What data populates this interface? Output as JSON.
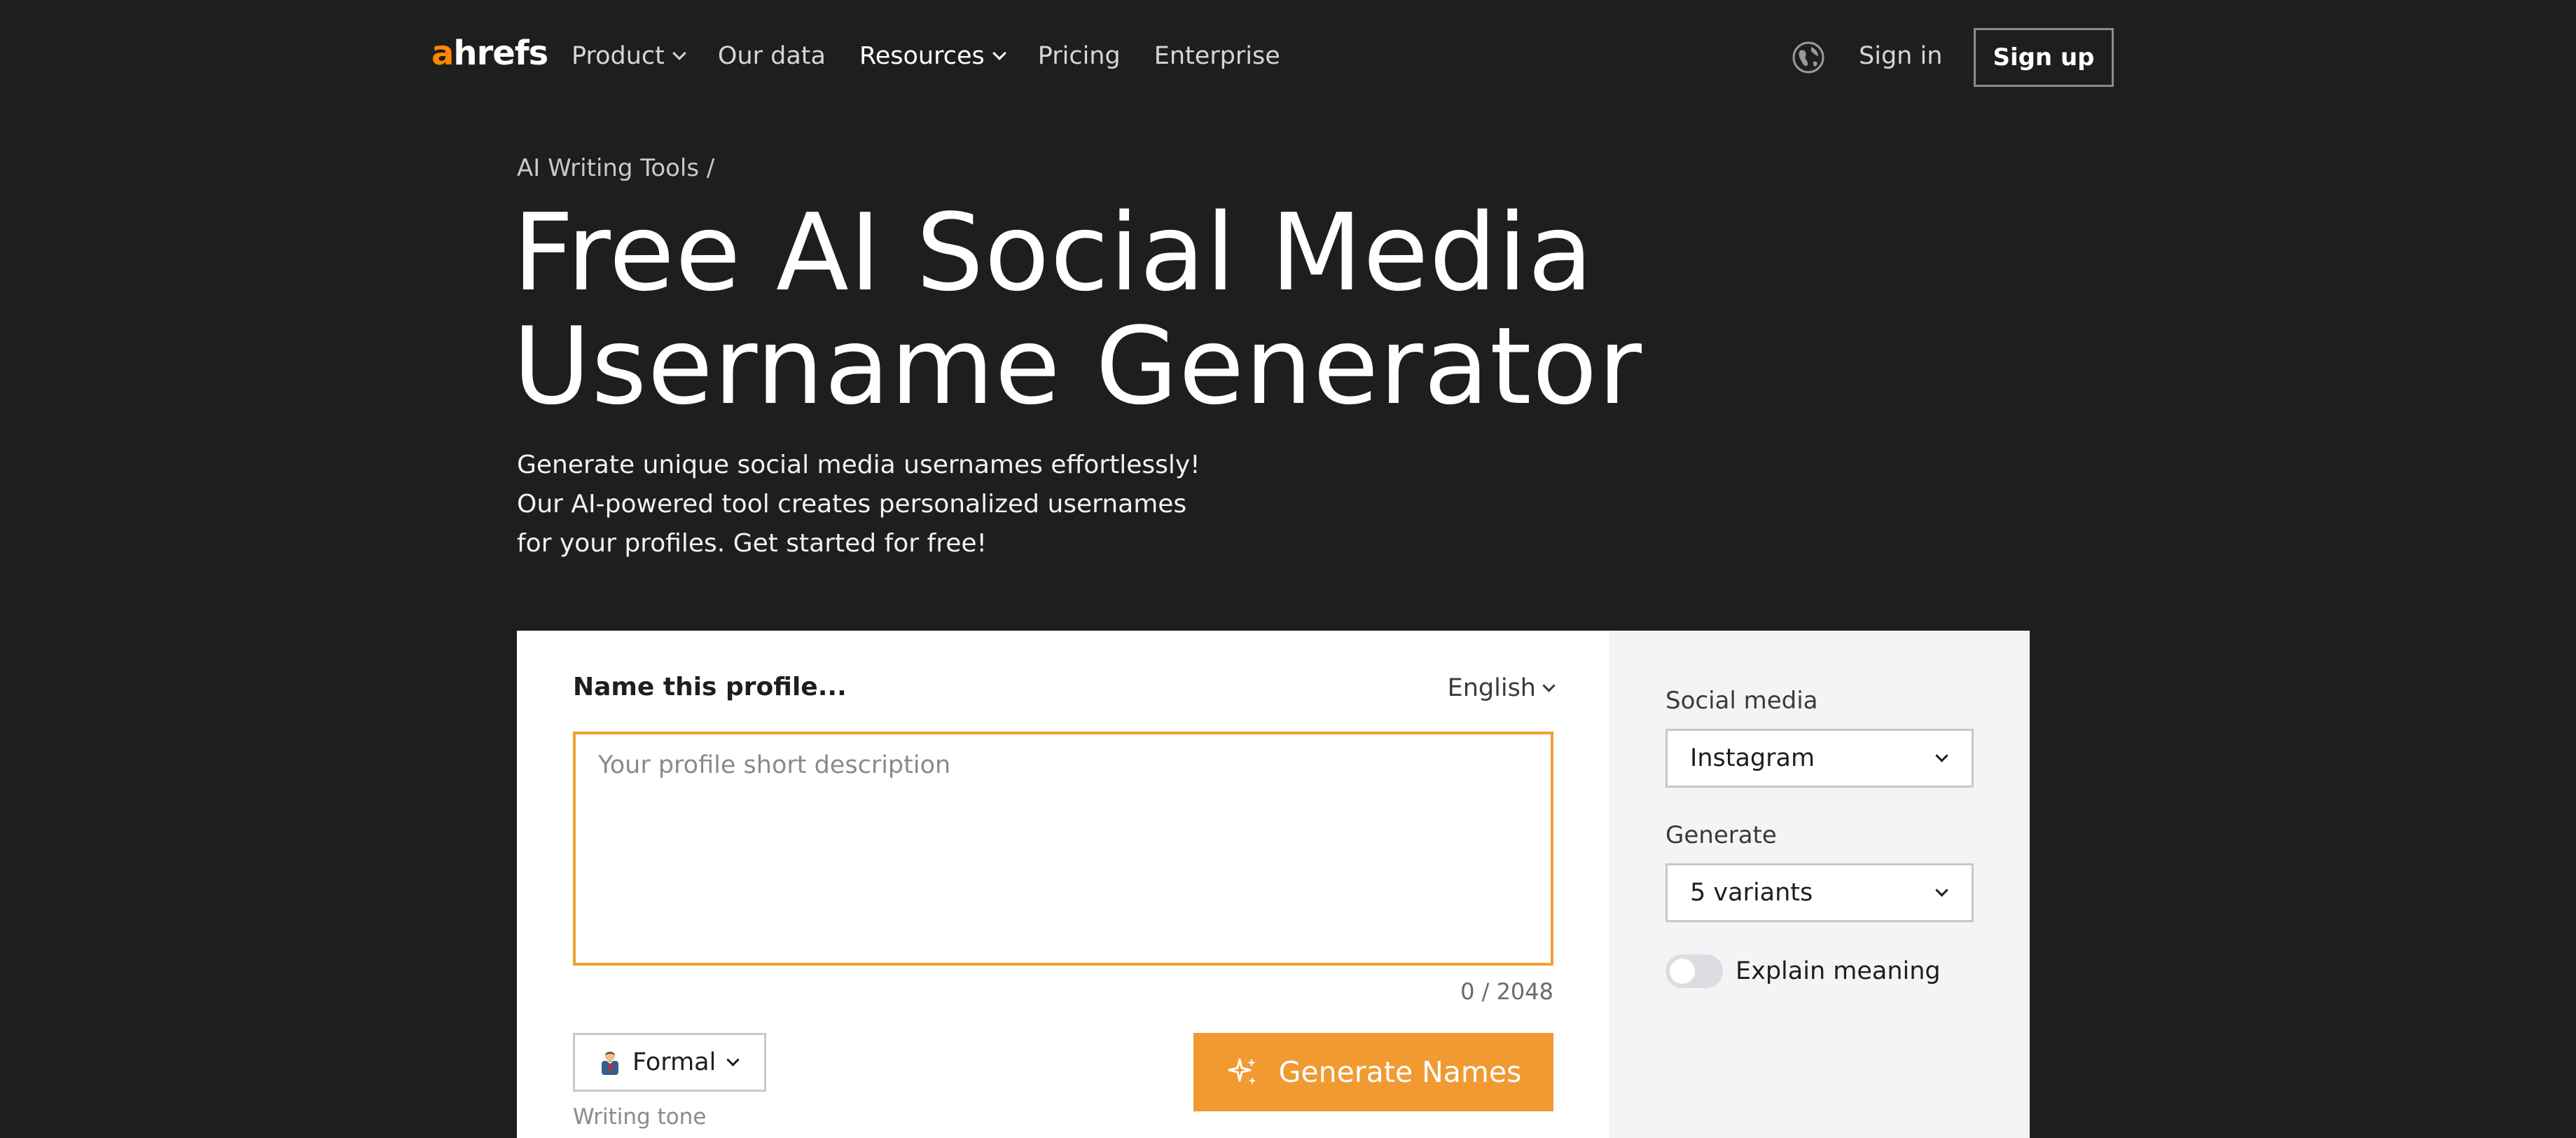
{
  "header": {
    "logo_first": "a",
    "logo_rest": "hrefs",
    "nav": [
      {
        "label": "Product"
      },
      {
        "label": "Our data"
      },
      {
        "label": "Resources"
      },
      {
        "label": "Pricing"
      },
      {
        "label": "Enterprise"
      }
    ],
    "sign_in": "Sign in",
    "sign_up": "Sign up"
  },
  "hero": {
    "breadcrumb": "AI Writing Tools /",
    "title_line1": "Free AI Social Media",
    "title_line2": "Username Generator",
    "desc_line1": "Generate unique social media usernames effortlessly!",
    "desc_line2": "Our AI-powered tool creates personalized usernames",
    "desc_line3": "for your profiles. Get started for free!"
  },
  "tool": {
    "profile_label": "Name this profile...",
    "language": "English",
    "input_placeholder": "Your profile short description",
    "input_value": "",
    "counter": "0 / 2048",
    "tone": "Formal",
    "tone_caption": "Writing tone",
    "generate_label": "Generate Names",
    "social_media_label": "Social media",
    "social_media_value": "Instagram",
    "generate_count_label": "Generate",
    "generate_count_value": "5 variants",
    "explain_label": "Explain meaning",
    "explain_enabled": false
  },
  "colors": {
    "background": "#1e1e1e",
    "accent": "#f09a31",
    "logo_accent": "#ff8800",
    "panel": "#f3f4f6"
  },
  "icons": [
    "chevron-down-icon",
    "globe-icon",
    "sparkle-icon",
    "tone-emoji-icon"
  ]
}
